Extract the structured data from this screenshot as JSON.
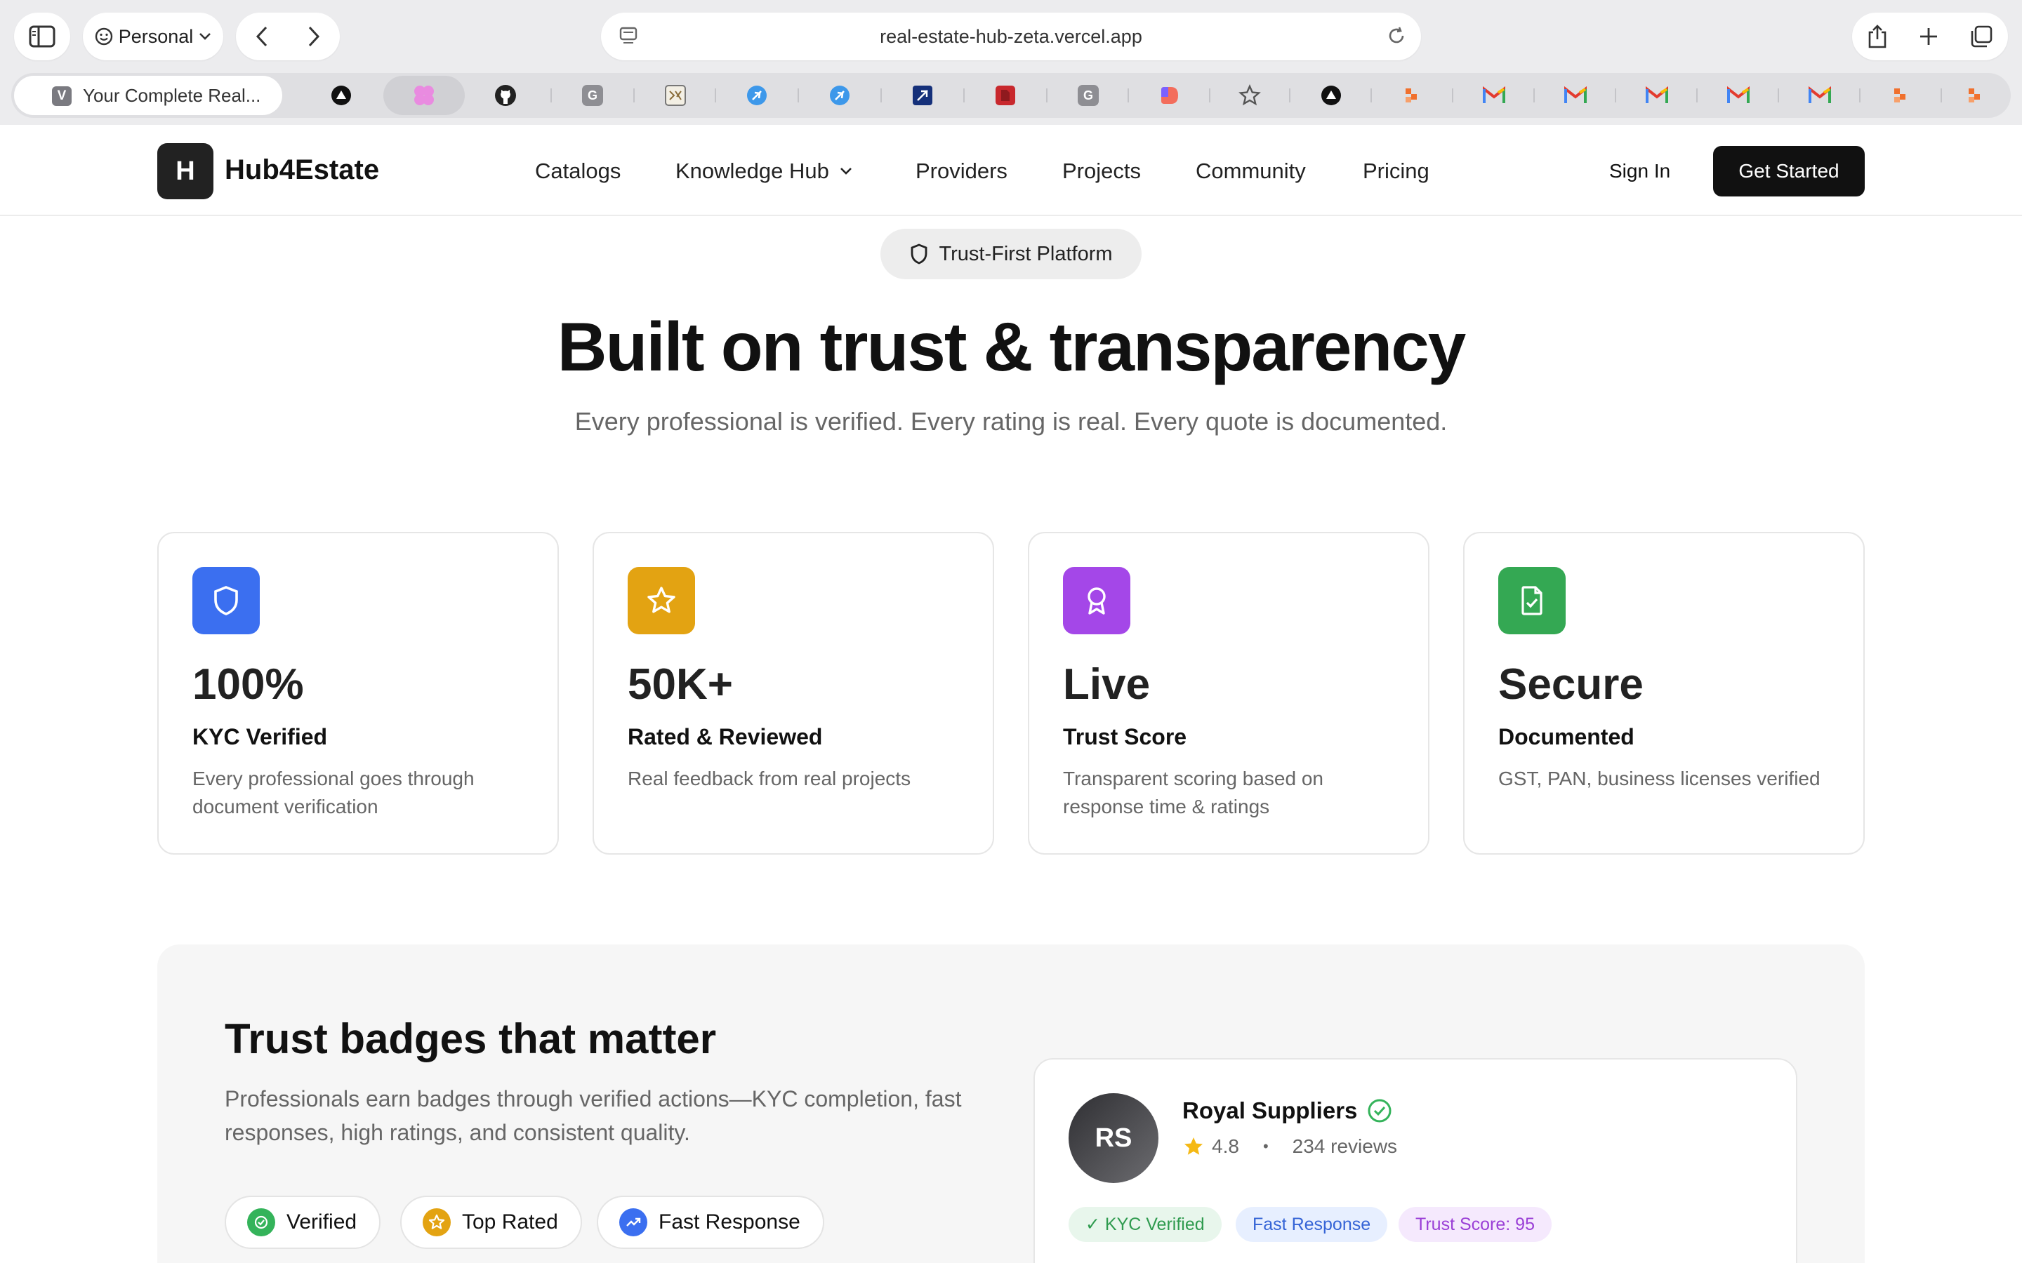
{
  "browser": {
    "profile_label": "Personal",
    "url": "real-estate-hub-zeta.vercel.app",
    "active_tab_initial": "V",
    "active_tab_title": "Your Complete Real...",
    "fav_g1": "G",
    "fav_g2": "G",
    "fav_gmail": "M"
  },
  "site": {
    "logo_letter": "H",
    "brand": "Hub4Estate",
    "nav": {
      "catalogs": "Catalogs",
      "knowledge_hub": "Knowledge Hub",
      "providers": "Providers",
      "projects": "Projects",
      "community": "Community",
      "pricing": "Pricing"
    },
    "sign_in": "Sign In",
    "get_started": "Get Started"
  },
  "hero": {
    "pill": "Trust-First Platform",
    "title": "Built on trust & transparency",
    "subtitle": "Every professional is verified. Every rating is real. Every quote is documented."
  },
  "stats": [
    {
      "value": "100%",
      "label": "KYC Verified",
      "desc": "Every professional goes through document verification",
      "icon": "shield-icon",
      "color": "#3b6ff0"
    },
    {
      "value": "50K+",
      "label": "Rated & Reviewed",
      "desc": "Real feedback from real projects",
      "icon": "star-icon",
      "color": "#e3a312"
    },
    {
      "value": "Live",
      "label": "Trust Score",
      "desc": "Transparent scoring based on response time & ratings",
      "icon": "award-icon",
      "color": "#a447e8"
    },
    {
      "value": "Secure",
      "label": "Documented",
      "desc": "GST, PAN, business licenses verified",
      "icon": "file-check-icon",
      "color": "#34a853"
    }
  ],
  "badges": {
    "title": "Trust badges that matter",
    "description": "Professionals earn badges through verified actions—KYC completion, fast responses, high ratings, and consistent quality.",
    "chips": [
      "Verified",
      "Top Rated",
      "Fast Response"
    ]
  },
  "profile": {
    "initials": "RS",
    "name": "Royal Suppliers",
    "rating": "4.8",
    "separator": "•",
    "reviews": "234 reviews",
    "tags": [
      "✓ KYC Verified",
      "Fast Response",
      "Trust Score: 95"
    ]
  }
}
